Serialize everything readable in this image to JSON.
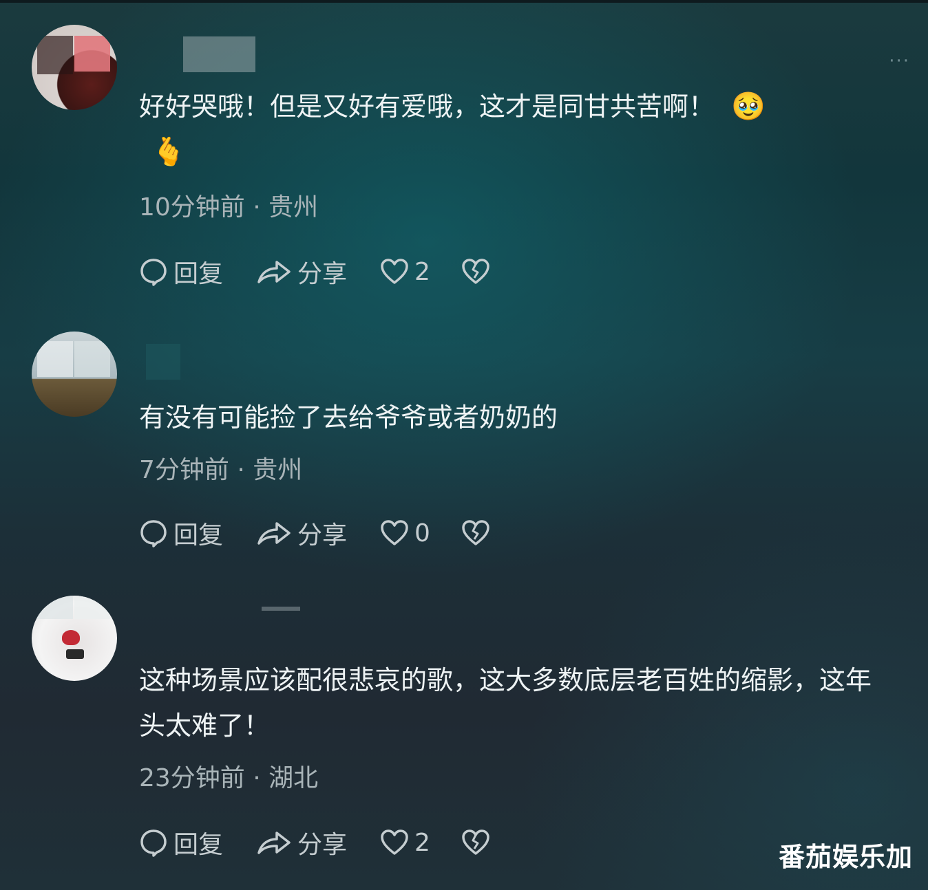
{
  "comments": [
    {
      "text": "好好哭哦！但是又好有爱哦，这才是同甘共苦啊！",
      "emoji_1": "🥹",
      "emoji_2": "🫰",
      "time": "10分钟前",
      "location": "贵州",
      "reply_label": "回复",
      "share_label": "分享",
      "likes": "2"
    },
    {
      "text": "有没有可能捡了去给爷爷或者奶奶的",
      "time": "7分钟前",
      "location": "贵州",
      "reply_label": "回复",
      "share_label": "分享",
      "likes": "0"
    },
    {
      "text": "这种场景应该配很悲哀的歌，这大多数底层老百姓的缩影，这年头太难了！",
      "time": "23分钟前",
      "location": "湖北",
      "reply_label": "回复",
      "share_label": "分享",
      "likes": "2"
    }
  ],
  "more_label": "···",
  "watermark": "番茄娱乐加",
  "colors": {
    "text": "#eef3f4",
    "meta": "#a9b4b8",
    "icon": "#c5cdd0"
  }
}
